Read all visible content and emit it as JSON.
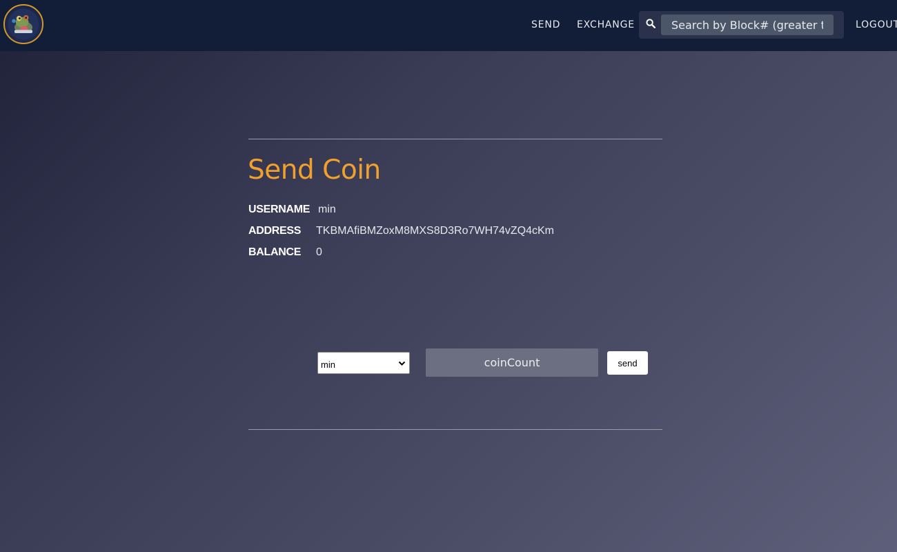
{
  "navbar": {
    "logo_icon": "coin-mascot-logo-icon",
    "links": {
      "send": "SEND",
      "exchange": "EXCHANGE",
      "logout": "LOGOUT"
    },
    "search": {
      "icon": "search-icon",
      "placeholder": "Search by Block# (greater than"
    }
  },
  "main": {
    "title": "Send Coin",
    "info": {
      "username_label": "USERNAME",
      "username_value": "min",
      "address_label": "ADDRESS",
      "address_value": "TKBMAfiBMZoxM8MXS8D3Ro7WH74vZQ4cKm",
      "balance_label": "BALANCE",
      "balance_value": "0"
    },
    "form": {
      "recipient_selected": "min",
      "coin_placeholder": "coinCount",
      "send_label": "send"
    }
  },
  "colors": {
    "navbar_bg": "#121d38",
    "title_accent": "#f0a02e",
    "logo_ring": "#d19a2a"
  }
}
